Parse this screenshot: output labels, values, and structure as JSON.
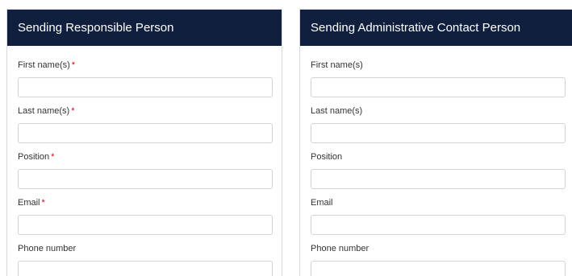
{
  "responsible": {
    "title": "Sending Responsible Person",
    "fields": [
      {
        "label": "First name(s)",
        "required_mark": "*",
        "value": ""
      },
      {
        "label": "Last name(s)",
        "required_mark": "*",
        "value": ""
      },
      {
        "label": "Position",
        "required_mark": "*",
        "value": ""
      },
      {
        "label": "Email",
        "required_mark": "*",
        "value": ""
      },
      {
        "label": "Phone number",
        "required_mark": "",
        "value": ""
      }
    ]
  },
  "contact": {
    "title": "Sending Administrative Contact Person",
    "fields": [
      {
        "label": "First name(s)",
        "value": ""
      },
      {
        "label": "Last name(s)",
        "value": ""
      },
      {
        "label": "Position",
        "value": ""
      },
      {
        "label": "Email",
        "value": ""
      },
      {
        "label": "Phone number",
        "value": ""
      }
    ]
  },
  "colors": {
    "header_bg": "#0f1f3d",
    "required_mark": "#d0021b",
    "input_border": "#ced4da"
  }
}
